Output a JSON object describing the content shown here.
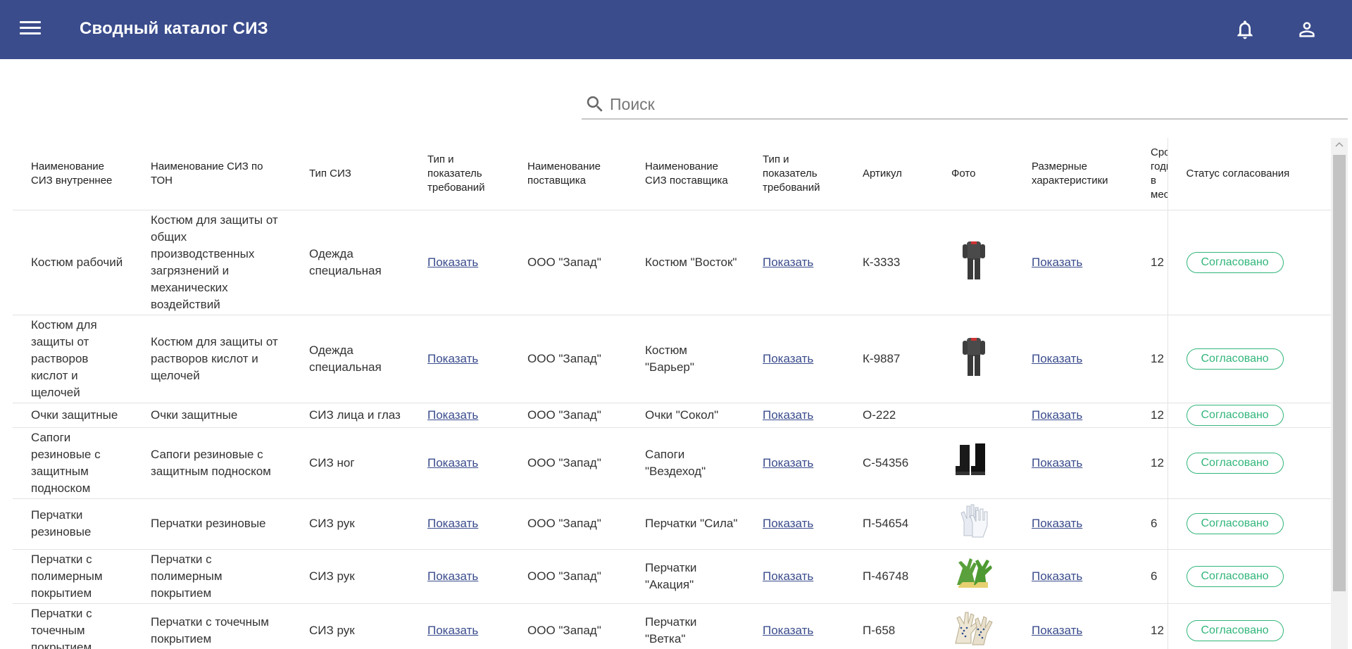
{
  "app": {
    "title": "Сводный каталог СИЗ"
  },
  "search": {
    "placeholder": "Поиск",
    "value": ""
  },
  "icons": {
    "menu": "menu-icon",
    "notifications": "bell-icon",
    "account": "account-icon",
    "search": "search-icon"
  },
  "colors": {
    "appbar": "#3a4c8c",
    "status_ok": "#31b57a",
    "link": "#3a4c8c"
  },
  "table": {
    "headers": {
      "internal_name": "Наименование СИЗ внутреннее",
      "ton_name": "Наименование СИЗ по ТОН",
      "type": "Тип СИЗ",
      "requirements": "Тип и показатель требований",
      "supplier": "Наименование поставщика",
      "supplier_name": "Наименование СИЗ поставщика",
      "requirements2": "Тип и показатель требований",
      "article": "Артикул",
      "photo": "Фото",
      "sizes": "Размерные характеристики",
      "shelf_life": "Срок годн в меся",
      "status": "Статус согласования"
    },
    "rows": [
      {
        "internal_name": "Костюм рабочий",
        "ton_name": "Костюм для защиты от общих производственных загрязнений и механических воздействий",
        "type": "Одежда специальная",
        "requirements": "Показать",
        "supplier": "ООО \"Запад\"",
        "supplier_name": "Костюм \"Восток\"",
        "requirements2": "Показать",
        "article": "К-3333",
        "photo": "suit",
        "sizes": "Показать",
        "shelf_life": "12",
        "status": "Согласовано"
      },
      {
        "internal_name": "Костюм для защиты от растворов кислот и щелочей",
        "ton_name": "Костюм для защиты от растворов кислот и щелочей",
        "type": "Одежда специальная",
        "requirements": "Показать",
        "supplier": "ООО \"Запад\"",
        "supplier_name": "Костюм \"Барьер\"",
        "requirements2": "Показать",
        "article": "К-9887",
        "photo": "suit",
        "sizes": "Показать",
        "shelf_life": "12",
        "status": "Согласовано"
      },
      {
        "internal_name": "Очки защитные",
        "ton_name": "Очки защитные",
        "type": "СИЗ лица и глаз",
        "requirements": "Показать",
        "supplier": "ООО \"Запад\"",
        "supplier_name": "Очки \"Сокол\"",
        "requirements2": "Показать",
        "article": "О-222",
        "photo": "",
        "sizes": "Показать",
        "shelf_life": "12",
        "status": "Согласовано"
      },
      {
        "internal_name": "Сапоги резиновые с защитным подноском",
        "ton_name": "Сапоги резиновые с защитным подноском",
        "type": "СИЗ ног",
        "requirements": "Показать",
        "supplier": "ООО \"Запад\"",
        "supplier_name": "Сапоги \"Вездеход\"",
        "requirements2": "Показать",
        "article": "С-54356",
        "photo": "boots",
        "sizes": "Показать",
        "shelf_life": "12",
        "status": "Согласовано"
      },
      {
        "internal_name": "Перчатки резиновые",
        "ton_name": "Перчатки резиновые",
        "type": "СИЗ рук",
        "requirements": "Показать",
        "supplier": "ООО \"Запад\"",
        "supplier_name": "Перчатки \"Сила\"",
        "requirements2": "Показать",
        "article": "П-54654",
        "photo": "gloves-white",
        "sizes": "Показать",
        "shelf_life": "6",
        "status": "Согласовано"
      },
      {
        "internal_name": "Перчатки с полимерным покрытием",
        "ton_name": "Перчатки с полимерным покрытием",
        "type": "СИЗ рук",
        "requirements": "Показать",
        "supplier": "ООО \"Запад\"",
        "supplier_name": "Перчатки \"Акация\"",
        "requirements2": "Показать",
        "article": "П-46748",
        "photo": "gloves-green",
        "sizes": "Показать",
        "shelf_life": "6",
        "status": "Согласовано"
      },
      {
        "internal_name": "Перчатки с точечным покрытием",
        "ton_name": "Перчатки с точечным покрытием",
        "type": "СИЗ рук",
        "requirements": "Показать",
        "supplier": "ООО \"Запад\"",
        "supplier_name": "Перчатки \"Ветка\"",
        "requirements2": "Показать",
        "article": "П-658",
        "photo": "gloves-dotted",
        "sizes": "Показать",
        "shelf_life": "12",
        "status": "Согласовано"
      }
    ]
  }
}
